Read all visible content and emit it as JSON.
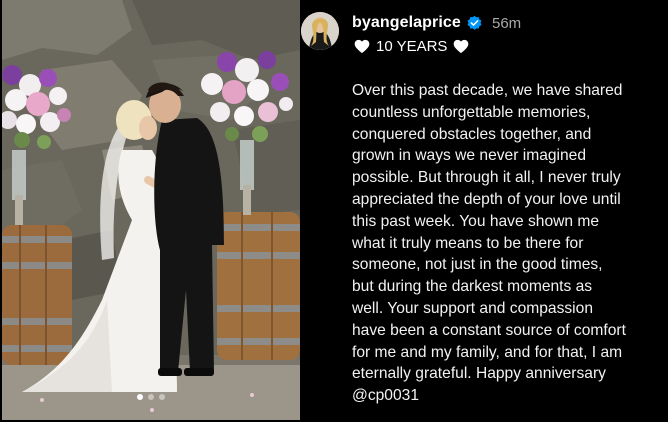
{
  "post": {
    "username": "byangelaprice",
    "timestamp": "56m",
    "title": "10 YEARS",
    "verified_icon": "verified-badge-icon",
    "heart_icon": "heart-icon",
    "caption_lines": [
      "Over this past decade, we have shared",
      "countless unforgettable memories,",
      "conquered obstacles together, and",
      "grown in ways we never imagined",
      "possible. But through it all, I never truly",
      "appreciated the depth of your love until",
      "this past week. You have shown me",
      "what it truly means to be there for",
      "someone, not just in the good times,",
      "but during the darkest moments as",
      "well. Your support and compassion",
      "have been a constant source of comfort",
      "for me and my family, and for that, I am",
      "eternally grateful. Happy anniversary",
      "@cp0031"
    ]
  },
  "carousel": {
    "slide_count": 3,
    "active_index": 0
  },
  "colors": {
    "background": "#000000",
    "text": "#f2f2f2",
    "muted": "#a8a8a8",
    "verified_blue": "#0095f6"
  }
}
